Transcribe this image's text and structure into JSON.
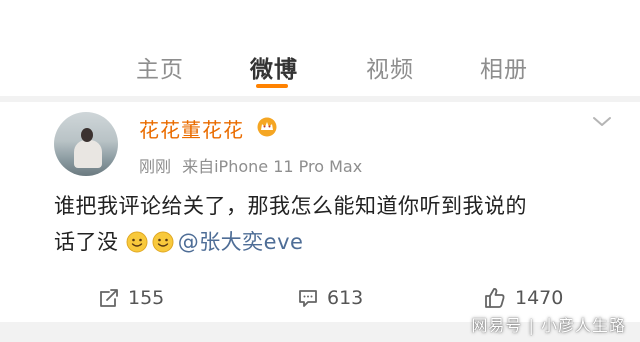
{
  "tabs": [
    {
      "label": "主页",
      "active": false
    },
    {
      "label": "微博",
      "active": true
    },
    {
      "label": "视频",
      "active": false
    },
    {
      "label": "相册",
      "active": false
    }
  ],
  "colors": {
    "accent": "#ff8200",
    "username": "#ea6c00",
    "mention": "#4e6d96"
  },
  "post": {
    "username": "花花董花花",
    "time": "刚刚",
    "source": "来自iPhone 11 Pro Max",
    "text_line1": "谁把我评论给关了，那我怎么能知道你听到我说的",
    "text_line2": "话了没",
    "mention": "@张大奕eve",
    "emoji_icons": [
      "smile-icon",
      "smile-icon"
    ],
    "reposts": "155",
    "comments": "613",
    "likes": "1470"
  },
  "watermark": "网易号 | 小彦人生路"
}
